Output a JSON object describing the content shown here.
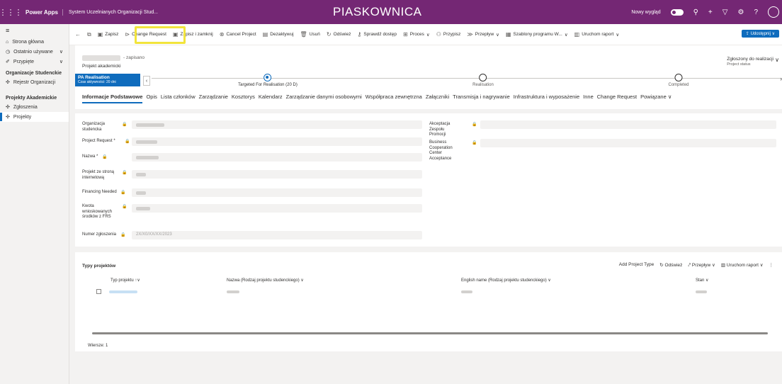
{
  "topbar": {
    "brand": "Power Apps",
    "app_name": "System Uczelnianych Organizacji Stud...",
    "environment": "PIASKOWNICA",
    "new_look_label": "Nowy wygląd",
    "help": "?"
  },
  "sidebar": {
    "home": "Strona główna",
    "recent": "Ostatnio używane",
    "pinned": "Przypięte",
    "section1": "Organizacje Studenckie",
    "registry": "Rejestr Organizacji",
    "section2": "Projekty Akademickie",
    "applications": "Zgłoszenia",
    "projects": "Projekty"
  },
  "commands": {
    "save": "Zapisz",
    "change_request": "Change Request",
    "save_close": "Zapisz i zamknij",
    "cancel_project": "Cancel Project",
    "deactivate": "Dezaktywuj",
    "delete": "Usuń",
    "refresh": "Odśwież",
    "check_access": "Sprawdź dostęp",
    "process": "Proces",
    "assign": "Przypisz",
    "flow": "Przepływ",
    "templates": "Szablony programu W...",
    "run_report": "Uruchom raport",
    "share": "Udostępnij"
  },
  "header": {
    "saved": "- zapisano",
    "entity": "Projekt akademicki",
    "status": "Zgłoszony do realizacji",
    "status_label": "Project status"
  },
  "bpf": {
    "active_title": "PA Realisation",
    "active_sub": "Czas aktywności: 20 dni",
    "stages": [
      {
        "label": "Targeted For Realisation  (20 D)"
      },
      {
        "label": "Realisation"
      },
      {
        "label": "Completed"
      }
    ]
  },
  "tabs": [
    "Informacje Podstawowe",
    "Opis",
    "Lista członków",
    "Zarządzanie",
    "Kosztorys",
    "Kalendarz",
    "Zarządzanie danymi osobowymi",
    "Współpraca zewnętrzna",
    "Załączniki",
    "Transmisja i nagrywanie",
    "Infrastruktura i wyposażenie",
    "Inne",
    "Change Request",
    "Powiązane"
  ],
  "form": {
    "org": "Organizacja studencka",
    "project_request": "Project Request *",
    "name": "Nazwa *",
    "website": "Projekt ze stroną internetową",
    "financing": "Financing Needed",
    "amount": "Kwota wnioskowanych środków z FRS",
    "number": "Numer zgłoszenia",
    "number_value": "2X/X0/XX/XX/2023",
    "promo": "Akceptacja Zespołu Promocji",
    "bcca": "Business Cooperation Center Acceptance"
  },
  "grid": {
    "title": "Typy projektów",
    "add": "Add Project Type",
    "refresh": "Odśwież",
    "flow": "Przepływ",
    "report": "Uruchom raport",
    "headers": {
      "type": "Typ projektu",
      "name": "Nazwa (Rodzaj projektu studenckiego)",
      "english": "English name (Rodzaj projektu studenckiego)",
      "state": "Stan"
    },
    "count": "Wiersze: 1"
  }
}
